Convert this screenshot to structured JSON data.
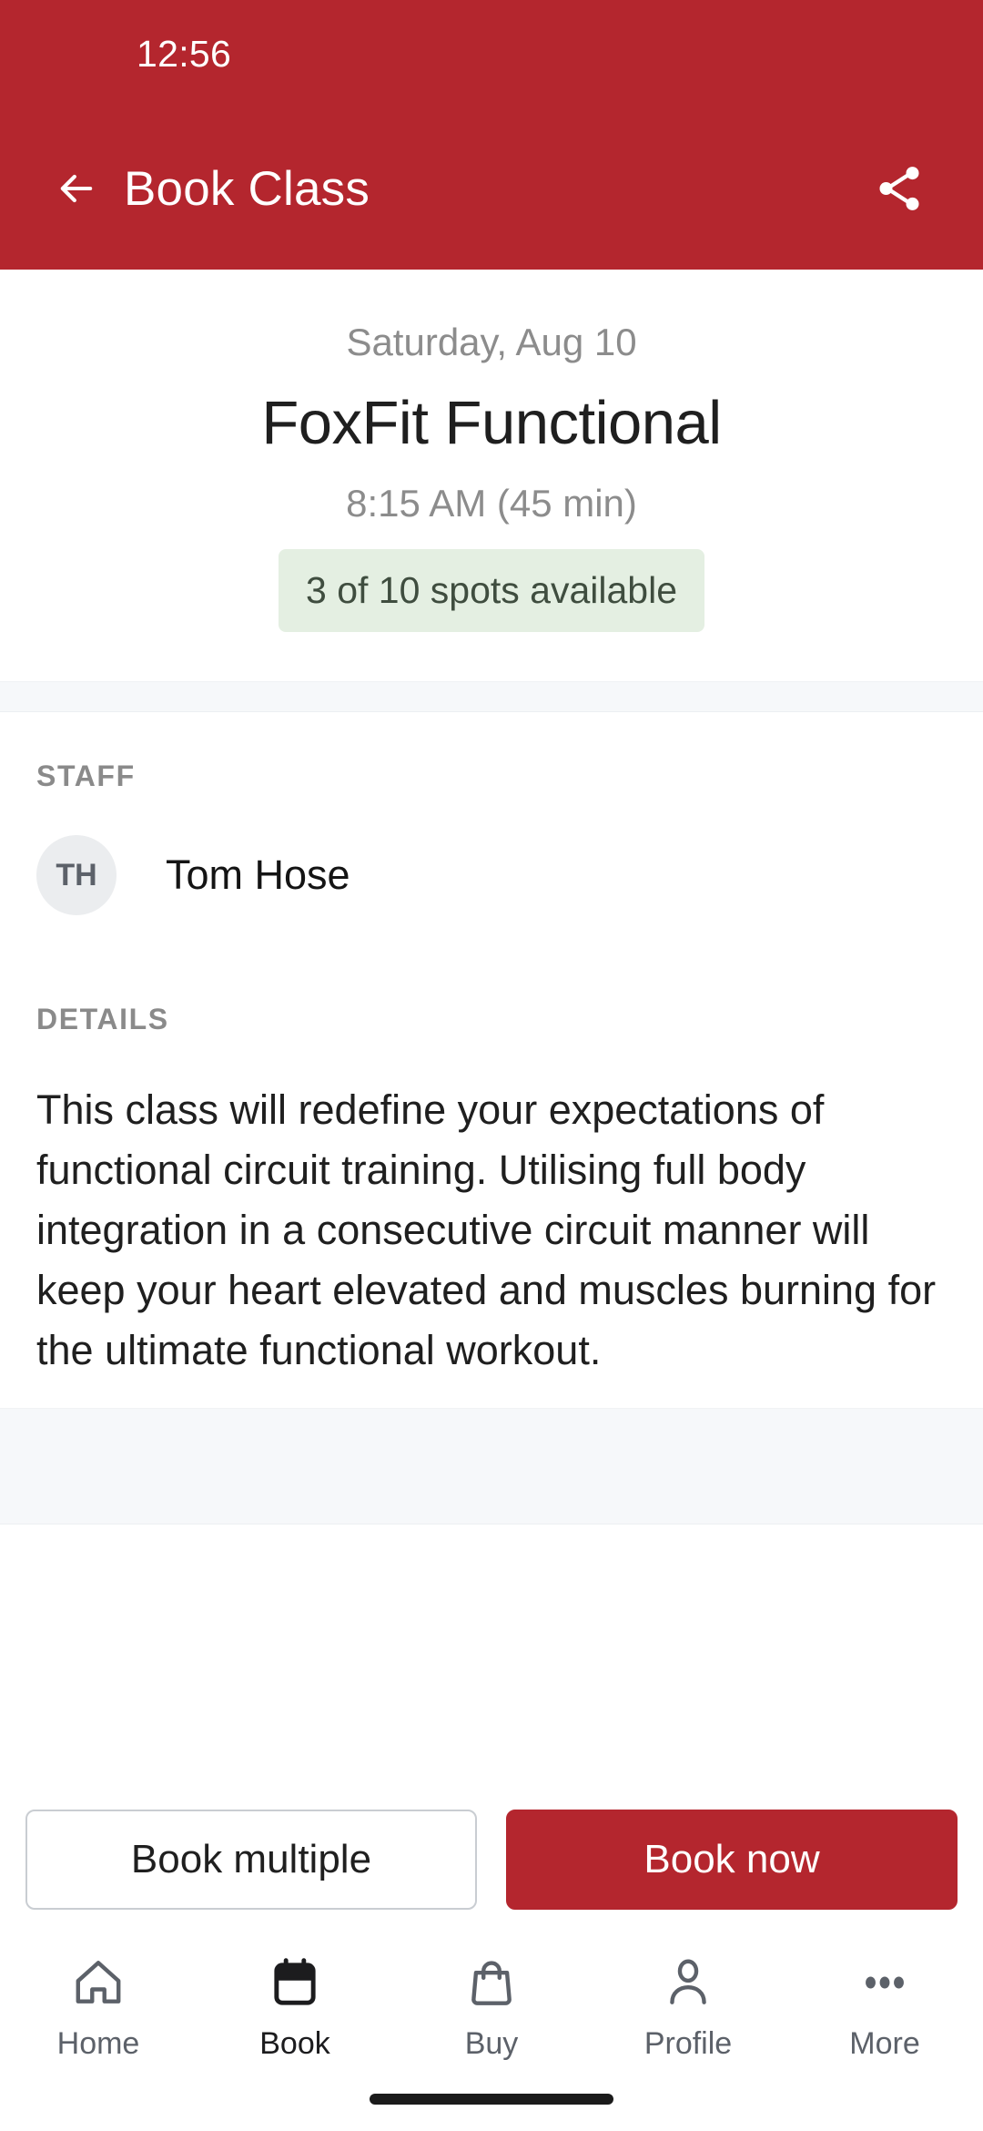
{
  "theme": {
    "brand_red": "#b4262e",
    "badge_bg": "#e4efe2",
    "badge_text": "#3f4d3f",
    "band_gray": "#f6f8fa",
    "avatar_bg": "#ebedef"
  },
  "status_bar": {
    "clock": "12:56"
  },
  "app_bar": {
    "title": "Book Class",
    "back_icon": "arrow-left-icon",
    "share_icon": "share-icon"
  },
  "class_header": {
    "date": "Saturday, Aug 10",
    "name": "FoxFit Functional",
    "time": "8:15 AM (45 min)",
    "spots_badge": "3 of 10 spots available"
  },
  "staff_section": {
    "label": "STAFF",
    "members": [
      {
        "initials": "TH",
        "name": "Tom Hose"
      }
    ]
  },
  "details_section": {
    "label": "DETAILS",
    "body": "This class will redefine your expectations of functional circuit training. Utilising full body integration in a consecutive circuit manner will keep your heart elevated and muscles burning for the ultimate functional workout."
  },
  "actions": {
    "secondary_label": "Book multiple",
    "primary_label": "Book now"
  },
  "bottom_nav": {
    "items": [
      {
        "label": "Home",
        "icon": "home-icon",
        "active": false
      },
      {
        "label": "Book",
        "icon": "calendar-icon",
        "active": true
      },
      {
        "label": "Buy",
        "icon": "shopping-bag-icon",
        "active": false
      },
      {
        "label": "Profile",
        "icon": "person-icon",
        "active": false
      },
      {
        "label": "More",
        "icon": "ellipsis-icon",
        "active": false
      }
    ]
  }
}
